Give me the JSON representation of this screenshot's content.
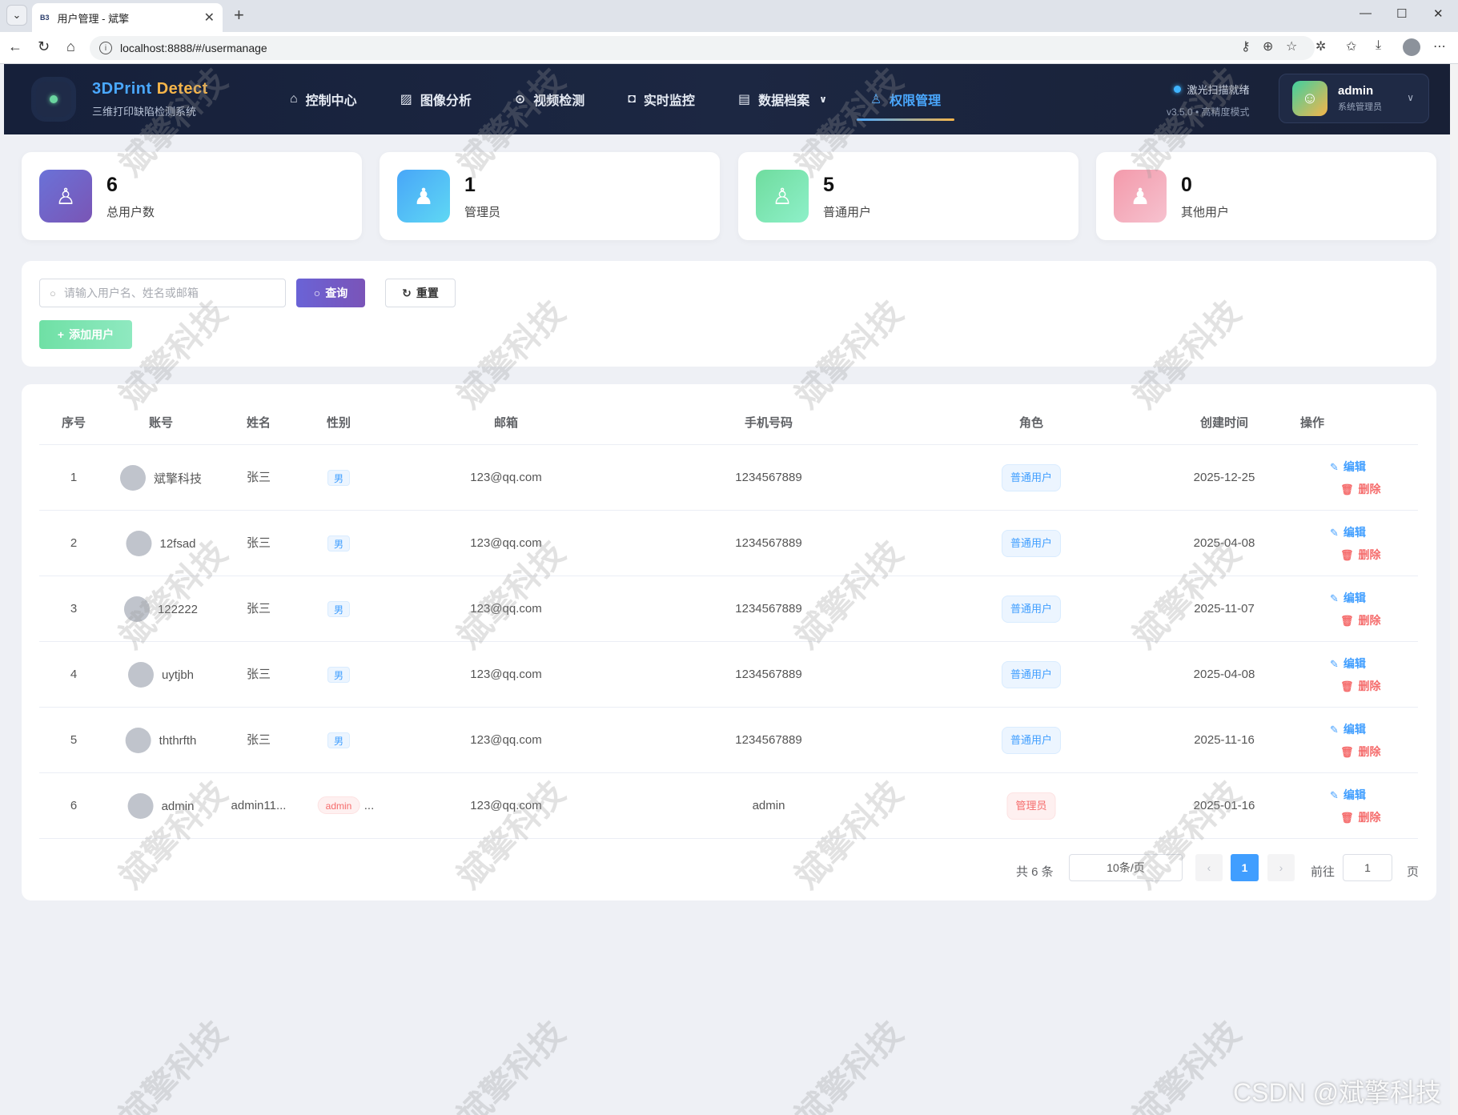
{
  "browser": {
    "tab_title": "用户管理 - 斌擎",
    "tab_favicon": "B3",
    "url": "localhost:8888/#/usermanage"
  },
  "app": {
    "brand_prefix": "3DPrint ",
    "brand_accent": "Detect",
    "brand_subtitle": "三维打印缺陷检测系统",
    "menu": [
      {
        "label": "控制中心",
        "icon": "home-icon"
      },
      {
        "label": "图像分析",
        "icon": "image-icon"
      },
      {
        "label": "视频检测",
        "icon": "play-icon"
      },
      {
        "label": "实时监控",
        "icon": "camera-icon"
      },
      {
        "label": "数据档案",
        "icon": "document-icon"
      },
      {
        "label": "权限管理",
        "icon": "user-icon"
      }
    ],
    "active_menu": "权限管理",
    "status_text": "激光扫描就绪",
    "version_text": "v3.5.0 • 高精度模式",
    "user_name": "admin",
    "user_role": "系统管理员",
    "colors": {
      "primary": "#409eff",
      "accent": "#f5b54a",
      "header_bg": "#1c2742"
    }
  },
  "stats": [
    {
      "value": "6",
      "label": "总用户数",
      "color": "#6a5fc4"
    },
    {
      "value": "1",
      "label": "管理员",
      "color": "#48b6f8"
    },
    {
      "value": "5",
      "label": "普通用户",
      "color": "#6edfa8"
    },
    {
      "value": "0",
      "label": "其他用户",
      "color": "#f1a2b2"
    }
  ],
  "search": {
    "placeholder": "请输入用户名、姓名或邮箱",
    "query_label": "查询",
    "reset_label": "重置",
    "add_label": "添加用户"
  },
  "table": {
    "headers": [
      "序号",
      "账号",
      "姓名",
      "性别",
      "邮箱",
      "手机号码",
      "角色",
      "创建时间",
      "操作"
    ],
    "rows": [
      {
        "no": "1",
        "account": "斌擎科技",
        "name": "张三",
        "gender": "男",
        "email": "123@qq.com",
        "phone": "1234567889",
        "role": "普通用户",
        "created": "2025-12-25"
      },
      {
        "no": "2",
        "account": "12fsad",
        "name": "张三",
        "gender": "男",
        "email": "123@qq.com",
        "phone": "1234567889",
        "role": "普通用户",
        "created": "2025-04-08"
      },
      {
        "no": "3",
        "account": "122222",
        "name": "张三",
        "gender": "男",
        "email": "123@qq.com",
        "phone": "1234567889",
        "role": "普通用户",
        "created": "2025-11-07"
      },
      {
        "no": "4",
        "account": "uytjbh",
        "name": "张三",
        "gender": "男",
        "email": "123@qq.com",
        "phone": "1234567889",
        "role": "普通用户",
        "created": "2025-04-08"
      },
      {
        "no": "5",
        "account": "ththrfth",
        "name": "张三",
        "gender": "男",
        "email": "123@qq.com",
        "phone": "1234567889",
        "role": "普通用户",
        "created": "2025-11-16"
      },
      {
        "no": "6",
        "account": "admin",
        "name": "admin11...",
        "gender": "admin",
        "gender_suffix": "...",
        "email": "123@qq.com",
        "phone": "admin",
        "role": "管理员",
        "created": "2025-01-16"
      }
    ],
    "edit_label": "编辑",
    "delete_label": "删除"
  },
  "pagination": {
    "total": "共 6 条",
    "page_size": "10条/页",
    "current_page": "1",
    "goto_label": "前往",
    "goto_value": "1",
    "page_unit": "页"
  },
  "watermark": "斌擎科技",
  "csdn_mark": "CSDN @斌擎科技"
}
